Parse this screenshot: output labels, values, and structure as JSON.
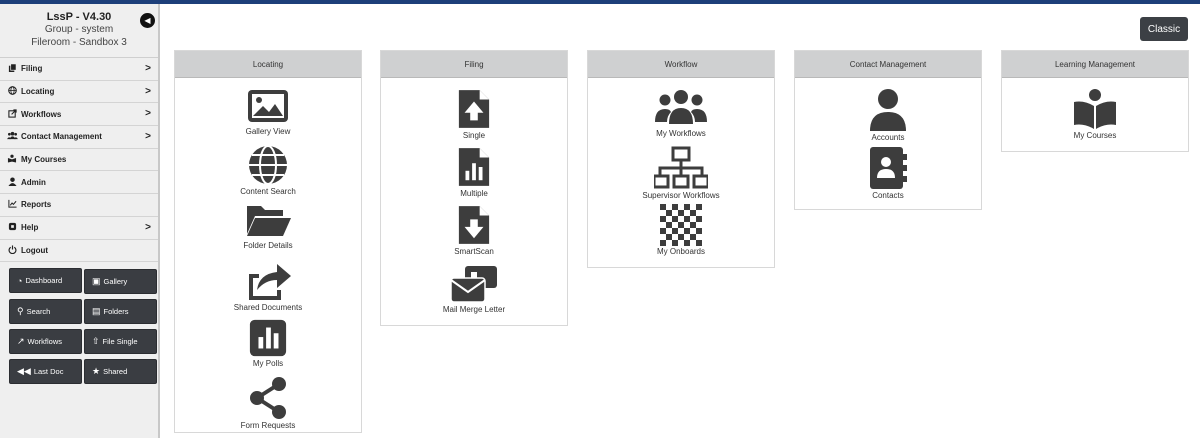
{
  "brand": {
    "title": "LssP - V4.30",
    "group": "Group - system",
    "fileroom": "Fileroom - Sandbox 3"
  },
  "menu": [
    {
      "label": "Filing",
      "icon": "filing-icon",
      "chevron": ">"
    },
    {
      "label": "Locating",
      "icon": "globe-icon",
      "chevron": ">"
    },
    {
      "label": "Workflows",
      "icon": "workflows-icon",
      "chevron": ">"
    },
    {
      "label": "Contact Management",
      "icon": "users-icon",
      "chevron": ">"
    },
    {
      "label": "My Courses",
      "icon": "courses-icon",
      "chevron": ""
    },
    {
      "label": "Admin",
      "icon": "user-icon",
      "chevron": ""
    },
    {
      "label": "Reports",
      "icon": "chart-icon",
      "chevron": ""
    },
    {
      "label": "Help",
      "icon": "help-icon",
      "chevron": ">"
    },
    {
      "label": "Logout",
      "icon": "power-icon",
      "chevron": ""
    }
  ],
  "quick_links": [
    {
      "label": "Dashboard",
      "icon": "dashboard-icon"
    },
    {
      "label": "Gallery",
      "icon": "gallery-icon"
    },
    {
      "label": "Search",
      "icon": "search-icon"
    },
    {
      "label": "Folders",
      "icon": "folders-icon"
    },
    {
      "label": "Workflows",
      "icon": "workflows-icon"
    },
    {
      "label": "File Single",
      "icon": "upload-icon"
    },
    {
      "label": "Last Doc",
      "icon": "rewind-icon"
    },
    {
      "label": "Shared",
      "icon": "star-icon"
    }
  ],
  "classic_label": "Classic",
  "panels": [
    {
      "title": "Locating",
      "items": [
        {
          "label": "Gallery View",
          "icon": "image-icon"
        },
        {
          "label": "Content Search",
          "icon": "globe-icon"
        },
        {
          "label": "Folder Details",
          "icon": "folder-open-icon"
        },
        {
          "label": "Shared Documents",
          "icon": "share-arrow-icon"
        },
        {
          "label": "My Polls",
          "icon": "poll-icon"
        },
        {
          "label": "Form Requests",
          "icon": "share-nodes-icon"
        }
      ]
    },
    {
      "title": "Filing",
      "items": [
        {
          "label": "Single",
          "icon": "file-upload-icon"
        },
        {
          "label": "Multiple",
          "icon": "file-chart-icon"
        },
        {
          "label": "SmartScan",
          "icon": "file-download-icon"
        },
        {
          "label": "Mail Merge Letter",
          "icon": "mail-merge-icon"
        }
      ]
    },
    {
      "title": "Workflow",
      "items": [
        {
          "label": "My Workflows",
          "icon": "group-icon"
        },
        {
          "label": "Supervisor Workflows",
          "icon": "sitemap-icon"
        },
        {
          "label": "My Onboards",
          "icon": "checker-icon"
        }
      ]
    },
    {
      "title": "Contact Management",
      "items": [
        {
          "label": "Accounts",
          "icon": "user-icon"
        },
        {
          "label": "Contacts",
          "icon": "address-book-icon"
        }
      ]
    },
    {
      "title": "Learning Management",
      "items": [
        {
          "label": "My Courses",
          "icon": "book-reader-icon"
        }
      ]
    }
  ]
}
